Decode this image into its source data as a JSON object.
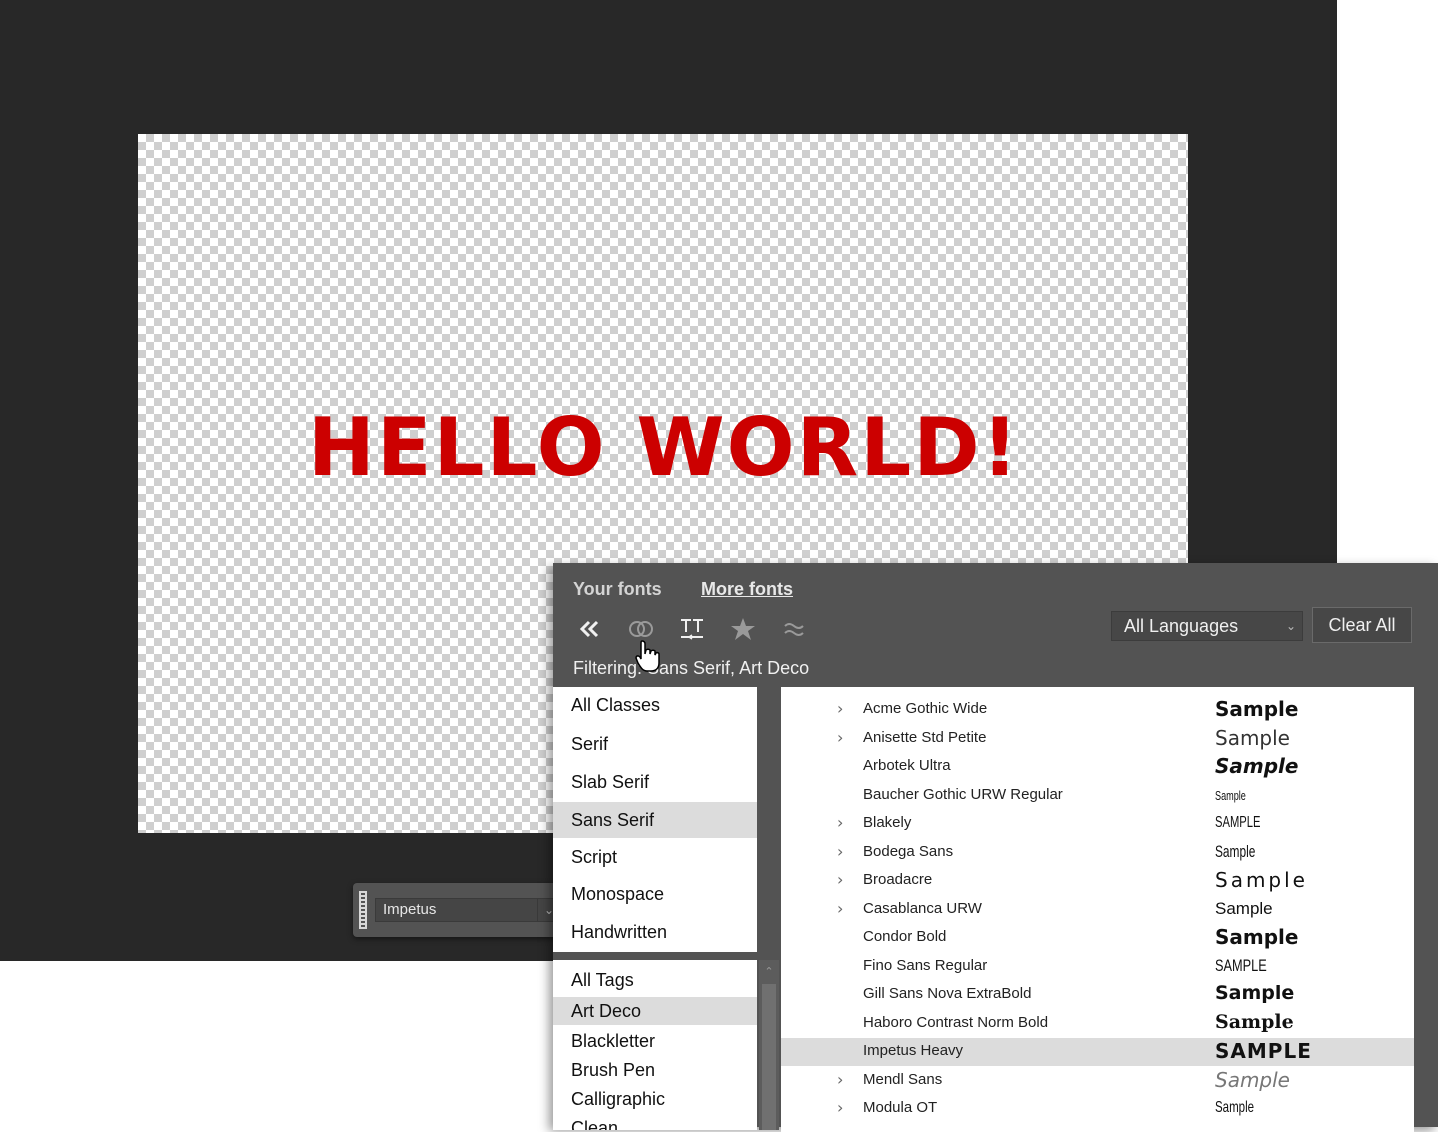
{
  "canvas": {
    "text": "HELLO WORLD!",
    "text_color": "#cc0000"
  },
  "toolbar": {
    "font_value": "Impetus"
  },
  "panel": {
    "tabs": {
      "your_fonts": "Your fonts",
      "more_fonts": "More fonts"
    },
    "icons": [
      "double-chevron-left-icon",
      "creative-cloud-icon",
      "similar-fonts-icon",
      "star-icon",
      "approx-icon"
    ],
    "language_select": "All Languages",
    "clear_all": "Clear All",
    "filter_status": "Filtering: Sans Serif, Art Deco",
    "classes": [
      "All Classes",
      "Serif",
      "Slab Serif",
      "Sans Serif",
      "Script",
      "Monospace",
      "Handwritten"
    ],
    "selected_class": "Sans Serif",
    "tags": [
      "All Tags",
      "Art Deco",
      "Blackletter",
      "Brush Pen",
      "Calligraphic",
      "Clean"
    ],
    "selected_tag": "Art Deco",
    "fonts": [
      {
        "name": "Acme Gothic Wide",
        "expandable": true,
        "sample": "Sample"
      },
      {
        "name": "Anisette Std Petite",
        "expandable": true,
        "sample": "Sample"
      },
      {
        "name": "Arbotek Ultra",
        "expandable": false,
        "sample": "Sample"
      },
      {
        "name": "Baucher Gothic URW Regular",
        "expandable": false,
        "sample": "Sample"
      },
      {
        "name": "Blakely",
        "expandable": true,
        "sample": "SAMPLE"
      },
      {
        "name": "Bodega Sans",
        "expandable": true,
        "sample": "Sample"
      },
      {
        "name": "Broadacre",
        "expandable": true,
        "sample": "Sample"
      },
      {
        "name": "Casablanca URW",
        "expandable": true,
        "sample": "Sample"
      },
      {
        "name": "Condor Bold",
        "expandable": false,
        "sample": "Sample"
      },
      {
        "name": "Fino Sans Regular",
        "expandable": false,
        "sample": "SAMPLE"
      },
      {
        "name": "Gill Sans Nova ExtraBold",
        "expandable": false,
        "sample": "Sample"
      },
      {
        "name": "Haboro Contrast Norm Bold",
        "expandable": false,
        "sample": "Sample"
      },
      {
        "name": "Impetus Heavy",
        "expandable": false,
        "sample": "SAMPLE"
      },
      {
        "name": "Mendl Sans",
        "expandable": true,
        "sample": "Sample"
      },
      {
        "name": "Modula OT",
        "expandable": true,
        "sample": "Sample"
      }
    ],
    "selected_font": "Impetus Heavy"
  }
}
